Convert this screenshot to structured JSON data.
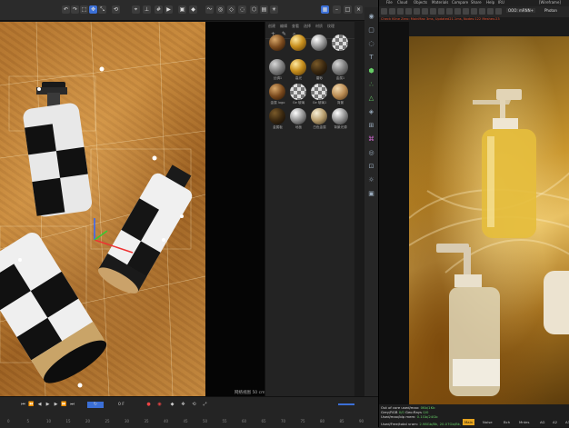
{
  "viewport": {
    "view_mode_label": "网络视图",
    "view_mode_value": "50 cm"
  },
  "material_panel": {
    "menu": [
      "创建",
      "编辑",
      "查看",
      "选择",
      "材质",
      "纹理"
    ],
    "materials": [
      {
        "label": "",
        "style": "ball-brown"
      },
      {
        "label": "",
        "style": "ball-gold"
      },
      {
        "label": "",
        "style": "ball-silver"
      },
      {
        "label": "",
        "style": "ball-checker"
      },
      {
        "label": "丝绸1",
        "style": "ball-grey"
      },
      {
        "label": "高光",
        "style": "ball-gold"
      },
      {
        "label": "磨砂",
        "style": "ball-dark"
      },
      {
        "label": "金属1",
        "style": "ball-grey"
      },
      {
        "label": "金属 logo",
        "style": "ball-brown"
      },
      {
        "label": "Ge 玻璃",
        "style": "ball-checker"
      },
      {
        "label": "Ge 玻璃1",
        "style": "ball-checker"
      },
      {
        "label": "背景",
        "style": "ball-tan"
      },
      {
        "label": "金属板",
        "style": "ball-dark"
      },
      {
        "label": "地板",
        "style": "ball-silver"
      },
      {
        "label": "白色金属",
        "style": "ball-glass"
      },
      {
        "label": "背景光源",
        "style": "ball-silver"
      }
    ]
  },
  "timeline": {
    "current_frame": "0 F",
    "ticks": [
      "0",
      "5",
      "10",
      "15",
      "20",
      "25",
      "30",
      "35",
      "40",
      "45",
      "50",
      "55",
      "60",
      "65",
      "70",
      "75",
      "80",
      "85",
      "90"
    ]
  },
  "render_window": {
    "menu": [
      "File",
      "Cloud",
      "Objects",
      "Materials",
      "Compare",
      "Share",
      "Help",
      "IRU"
    ],
    "preset": "OOO: mRNN+",
    "display_mode": "Photon",
    "window_title": "[Wireframe]",
    "stat_line": "Check Kline Zero: MainMax 3ms, Updated21.1ms, Nodes:122 Meshes:23",
    "status": {
      "line1_label": "Out of core used/max:",
      "line1_value": "0Kb/1Kb",
      "line2_label": "Grey/RGB",
      "line2_value": "0/0",
      "line3_label": "Used/max/blp mem:",
      "line3_value": "0.1Gb/24Gb",
      "line4_label": "Geo:Rays",
      "line4_value": "0/0",
      "line5_label": "Used/Free/total vram:",
      "line5_value": "2.98Gb/Bk, 20.07Gb/Bk, 24Gb"
    },
    "tabs": [
      "Main",
      "Noise",
      "Bch",
      "Mntes",
      "AG",
      "A2",
      "A3"
    ],
    "active_tab": "Main"
  }
}
